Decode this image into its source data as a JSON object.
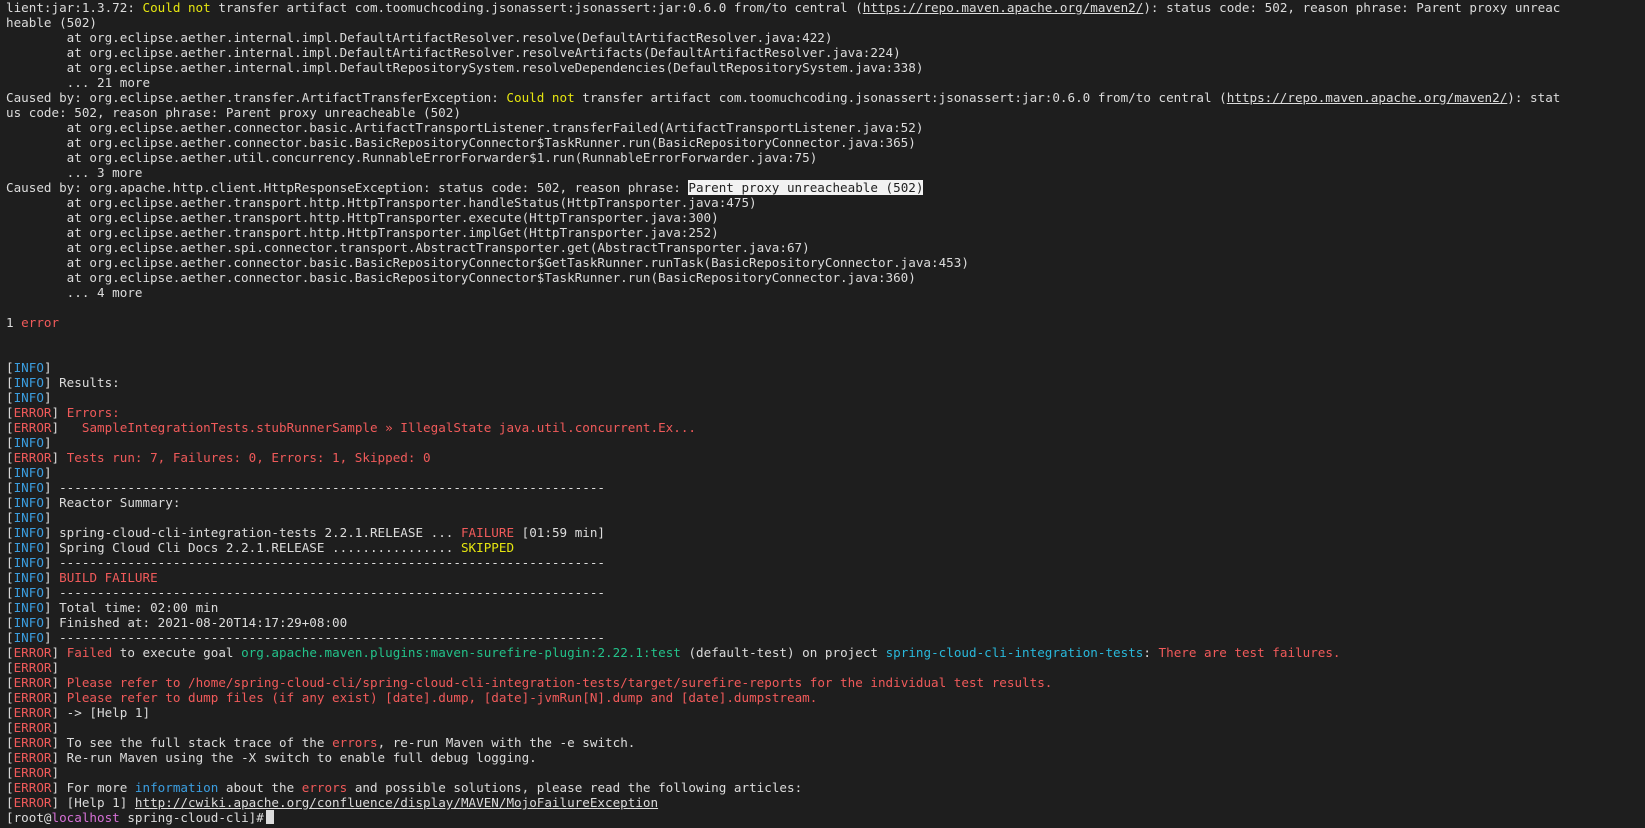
{
  "colors": {
    "background": "#1e1e1e",
    "default": "#dcdcdc",
    "yellow": "#e5e510",
    "red": "#f05a5a",
    "blue": "#3b9ee0",
    "green": "#23c28a",
    "cyan": "#29b8db",
    "magenta": "#d670d6",
    "selection_bg": "#f2f2f2"
  },
  "lines": [
    [
      {
        "t": "lient:jar:1.3.72: ",
        "c": "d"
      },
      {
        "t": "Could not",
        "c": "y"
      },
      {
        "t": " transfer artifact com.toomuchcoding.jsonassert:jsonassert:jar:0.6.0 from/to central (",
        "c": "d"
      },
      {
        "t": "https://repo.maven.apache.org/maven2/",
        "c": "d",
        "u": true
      },
      {
        "t": "): status code: 502, reason phrase: Parent proxy unreac",
        "c": "d"
      }
    ],
    [
      {
        "t": "heable (502)",
        "c": "d"
      }
    ],
    [
      {
        "t": "        at org.eclipse.aether.internal.impl.DefaultArtifactResolver.resolve(DefaultArtifactResolver.java:422)",
        "c": "d"
      }
    ],
    [
      {
        "t": "        at org.eclipse.aether.internal.impl.DefaultArtifactResolver.resolveArtifacts(DefaultArtifactResolver.java:224)",
        "c": "d"
      }
    ],
    [
      {
        "t": "        at org.eclipse.aether.internal.impl.DefaultRepositorySystem.resolveDependencies(DefaultRepositorySystem.java:338)",
        "c": "d"
      }
    ],
    [
      {
        "t": "        ... 21 more",
        "c": "d"
      }
    ],
    [
      {
        "t": "Caused by: org.eclipse.aether.transfer.ArtifactTransferException: ",
        "c": "d"
      },
      {
        "t": "Could not",
        "c": "y"
      },
      {
        "t": " transfer artifact com.toomuchcoding.jsonassert:jsonassert:jar:0.6.0 from/to central (",
        "c": "d"
      },
      {
        "t": "https://repo.maven.apache.org/maven2/",
        "c": "d",
        "u": true
      },
      {
        "t": "): stat",
        "c": "d"
      }
    ],
    [
      {
        "t": "us code: 502, reason phrase: Parent proxy unreacheable (502)",
        "c": "d"
      }
    ],
    [
      {
        "t": "        at org.eclipse.aether.connector.basic.ArtifactTransportListener.transferFailed(ArtifactTransportListener.java:52)",
        "c": "d"
      }
    ],
    [
      {
        "t": "        at org.eclipse.aether.connector.basic.BasicRepositoryConnector$TaskRunner.run(BasicRepositoryConnector.java:365)",
        "c": "d"
      }
    ],
    [
      {
        "t": "        at org.eclipse.aether.util.concurrency.RunnableErrorForwarder$1.run(RunnableErrorForwarder.java:75)",
        "c": "d"
      }
    ],
    [
      {
        "t": "        ... 3 more",
        "c": "d"
      }
    ],
    [
      {
        "t": "Caused by: org.apache.http.client.HttpResponseException: status code: 502, reason phrase: ",
        "c": "d"
      },
      {
        "t": "Parent proxy unreacheable (502)",
        "c": "d",
        "sel": true
      }
    ],
    [
      {
        "t": "        at org.eclipse.aether.transport.http.HttpTransporter.handleStatus(HttpTransporter.java:475)",
        "c": "d"
      }
    ],
    [
      {
        "t": "        at org.eclipse.aether.transport.http.HttpTransporter.execute(HttpTransporter.java:300)",
        "c": "d"
      }
    ],
    [
      {
        "t": "        at org.eclipse.aether.transport.http.HttpTransporter.implGet(HttpTransporter.java:252)",
        "c": "d"
      }
    ],
    [
      {
        "t": "        at org.eclipse.aether.spi.connector.transport.AbstractTransporter.get(AbstractTransporter.java:67)",
        "c": "d"
      }
    ],
    [
      {
        "t": "        at org.eclipse.aether.connector.basic.BasicRepositoryConnector$GetTaskRunner.runTask(BasicRepositoryConnector.java:453)",
        "c": "d"
      }
    ],
    [
      {
        "t": "        at org.eclipse.aether.connector.basic.BasicRepositoryConnector$TaskRunner.run(BasicRepositoryConnector.java:360)",
        "c": "d"
      }
    ],
    [
      {
        "t": "        ... 4 more",
        "c": "d"
      }
    ],
    [],
    [
      {
        "t": "1 ",
        "c": "d"
      },
      {
        "t": "error",
        "c": "r"
      }
    ],
    [],
    [],
    [
      {
        "t": "[",
        "c": "d"
      },
      {
        "t": "INFO",
        "c": "b"
      },
      {
        "t": "]",
        "c": "d"
      }
    ],
    [
      {
        "t": "[",
        "c": "d"
      },
      {
        "t": "INFO",
        "c": "b"
      },
      {
        "t": "] Results:",
        "c": "d"
      }
    ],
    [
      {
        "t": "[",
        "c": "d"
      },
      {
        "t": "INFO",
        "c": "b"
      },
      {
        "t": "]",
        "c": "d"
      }
    ],
    [
      {
        "t": "[",
        "c": "d"
      },
      {
        "t": "ERROR",
        "c": "r"
      },
      {
        "t": "] ",
        "c": "d"
      },
      {
        "t": "Errors:",
        "c": "r"
      }
    ],
    [
      {
        "t": "[",
        "c": "d"
      },
      {
        "t": "ERROR",
        "c": "r"
      },
      {
        "t": "]   ",
        "c": "d"
      },
      {
        "t": "SampleIntegrationTests.stubRunnerSample » IllegalState java.util.concurrent.Ex...",
        "c": "r"
      }
    ],
    [
      {
        "t": "[",
        "c": "d"
      },
      {
        "t": "INFO",
        "c": "b"
      },
      {
        "t": "]",
        "c": "d"
      }
    ],
    [
      {
        "t": "[",
        "c": "d"
      },
      {
        "t": "ERROR",
        "c": "r"
      },
      {
        "t": "] ",
        "c": "d"
      },
      {
        "t": "Tests run: 7, Failures: 0, Errors: 1, Skipped: 0",
        "c": "r"
      }
    ],
    [
      {
        "t": "[",
        "c": "d"
      },
      {
        "t": "INFO",
        "c": "b"
      },
      {
        "t": "]",
        "c": "d"
      }
    ],
    [
      {
        "t": "[",
        "c": "d"
      },
      {
        "t": "INFO",
        "c": "b"
      },
      {
        "t": "] ------------------------------------------------------------------------",
        "c": "d"
      }
    ],
    [
      {
        "t": "[",
        "c": "d"
      },
      {
        "t": "INFO",
        "c": "b"
      },
      {
        "t": "] Reactor Summary:",
        "c": "d"
      }
    ],
    [
      {
        "t": "[",
        "c": "d"
      },
      {
        "t": "INFO",
        "c": "b"
      },
      {
        "t": "]",
        "c": "d"
      }
    ],
    [
      {
        "t": "[",
        "c": "d"
      },
      {
        "t": "INFO",
        "c": "b"
      },
      {
        "t": "] spring-cloud-cli-integration-tests 2.2.1.RELEASE ... ",
        "c": "d"
      },
      {
        "t": "FAILURE",
        "c": "r"
      },
      {
        "t": " [01:59 min]",
        "c": "d"
      }
    ],
    [
      {
        "t": "[",
        "c": "d"
      },
      {
        "t": "INFO",
        "c": "b"
      },
      {
        "t": "] Spring Cloud Cli Docs 2.2.1.RELEASE ................ ",
        "c": "d"
      },
      {
        "t": "SKIPPED",
        "c": "y"
      }
    ],
    [
      {
        "t": "[",
        "c": "d"
      },
      {
        "t": "INFO",
        "c": "b"
      },
      {
        "t": "] ------------------------------------------------------------------------",
        "c": "d"
      }
    ],
    [
      {
        "t": "[",
        "c": "d"
      },
      {
        "t": "INFO",
        "c": "b"
      },
      {
        "t": "] ",
        "c": "d"
      },
      {
        "t": "BUILD FAILURE",
        "c": "r"
      }
    ],
    [
      {
        "t": "[",
        "c": "d"
      },
      {
        "t": "INFO",
        "c": "b"
      },
      {
        "t": "] ------------------------------------------------------------------------",
        "c": "d"
      }
    ],
    [
      {
        "t": "[",
        "c": "d"
      },
      {
        "t": "INFO",
        "c": "b"
      },
      {
        "t": "] Total time: 02:00 min",
        "c": "d"
      }
    ],
    [
      {
        "t": "[",
        "c": "d"
      },
      {
        "t": "INFO",
        "c": "b"
      },
      {
        "t": "] Finished at: 2021-08-20T14:17:29+08:00",
        "c": "d"
      }
    ],
    [
      {
        "t": "[",
        "c": "d"
      },
      {
        "t": "INFO",
        "c": "b"
      },
      {
        "t": "] ------------------------------------------------------------------------",
        "c": "d"
      }
    ],
    [
      {
        "t": "[",
        "c": "d"
      },
      {
        "t": "ERROR",
        "c": "r"
      },
      {
        "t": "] ",
        "c": "d"
      },
      {
        "t": "Failed",
        "c": "r"
      },
      {
        "t": " to execute goal ",
        "c": "d"
      },
      {
        "t": "org.apache.maven.plugins:maven-surefire-plugin:2.22.1:test",
        "c": "g"
      },
      {
        "t": " (default-test) on project ",
        "c": "d"
      },
      {
        "t": "spring-cloud-cli-integration-tests",
        "c": "c"
      },
      {
        "t": ": ",
        "c": "d"
      },
      {
        "t": "There are test failures.",
        "c": "r"
      }
    ],
    [
      {
        "t": "[",
        "c": "d"
      },
      {
        "t": "ERROR",
        "c": "r"
      },
      {
        "t": "]",
        "c": "d"
      }
    ],
    [
      {
        "t": "[",
        "c": "d"
      },
      {
        "t": "ERROR",
        "c": "r"
      },
      {
        "t": "] ",
        "c": "d"
      },
      {
        "t": "Please refer to /home/spring-cloud-cli/spring-cloud-cli-integration-tests/target/surefire-reports for the individual test results.",
        "c": "r"
      }
    ],
    [
      {
        "t": "[",
        "c": "d"
      },
      {
        "t": "ERROR",
        "c": "r"
      },
      {
        "t": "] ",
        "c": "d"
      },
      {
        "t": "Please refer to dump files (if any exist) [date].dump, [date]-jvmRun[N].dump and [date].dumpstream.",
        "c": "r"
      }
    ],
    [
      {
        "t": "[",
        "c": "d"
      },
      {
        "t": "ERROR",
        "c": "r"
      },
      {
        "t": "] -> [Help 1]",
        "c": "d"
      }
    ],
    [
      {
        "t": "[",
        "c": "d"
      },
      {
        "t": "ERROR",
        "c": "r"
      },
      {
        "t": "]",
        "c": "d"
      }
    ],
    [
      {
        "t": "[",
        "c": "d"
      },
      {
        "t": "ERROR",
        "c": "r"
      },
      {
        "t": "] To see the full stack trace of the ",
        "c": "d"
      },
      {
        "t": "errors",
        "c": "r"
      },
      {
        "t": ", re-run Maven with the -e switch.",
        "c": "d"
      }
    ],
    [
      {
        "t": "[",
        "c": "d"
      },
      {
        "t": "ERROR",
        "c": "r"
      },
      {
        "t": "] Re-run Maven using the -X switch to enable full debug logging.",
        "c": "d"
      }
    ],
    [
      {
        "t": "[",
        "c": "d"
      },
      {
        "t": "ERROR",
        "c": "r"
      },
      {
        "t": "]",
        "c": "d"
      }
    ],
    [
      {
        "t": "[",
        "c": "d"
      },
      {
        "t": "ERROR",
        "c": "r"
      },
      {
        "t": "] For more ",
        "c": "d"
      },
      {
        "t": "information",
        "c": "b"
      },
      {
        "t": " about the ",
        "c": "d"
      },
      {
        "t": "errors",
        "c": "r"
      },
      {
        "t": " and possible solutions, please read the following articles:",
        "c": "d"
      }
    ],
    [
      {
        "t": "[",
        "c": "d"
      },
      {
        "t": "ERROR",
        "c": "r"
      },
      {
        "t": "] [Help 1] ",
        "c": "d"
      },
      {
        "t": "http://cwiki.apache.org/confluence/display/MAVEN/MojoFailureException",
        "c": "d",
        "u": true
      }
    ]
  ],
  "prompt": {
    "open": "[root@",
    "host": "localhost",
    "rest": " spring-cloud-cli]#"
  }
}
